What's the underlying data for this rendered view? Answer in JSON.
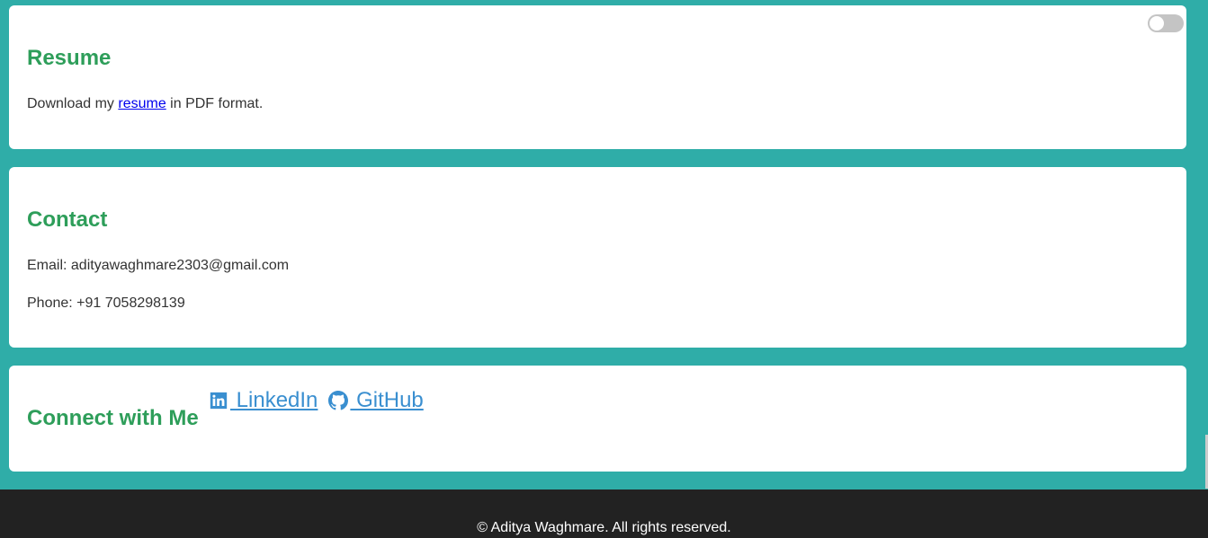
{
  "resume": {
    "heading": "Resume",
    "text_before": "Download my ",
    "link_text": "resume",
    "text_after": " in PDF format."
  },
  "contact": {
    "heading": "Contact",
    "email": "Email: adityawaghmare2303@gmail.com",
    "phone": "Phone: +91 7058298139"
  },
  "connect": {
    "heading": "Connect with Me",
    "links": [
      {
        "label": " LinkedIn",
        "icon": "linkedin-icon"
      },
      {
        "label": " GitHub",
        "icon": "github-icon"
      }
    ]
  },
  "theme_toggle": {
    "state": "off"
  },
  "footer": {
    "text": "© Aditya Waghmare. All rights reserved."
  },
  "colors": {
    "background": "#2fada8",
    "heading": "#2e9e5a",
    "social_link": "#3a8fd0",
    "footer_bg": "#222222"
  }
}
